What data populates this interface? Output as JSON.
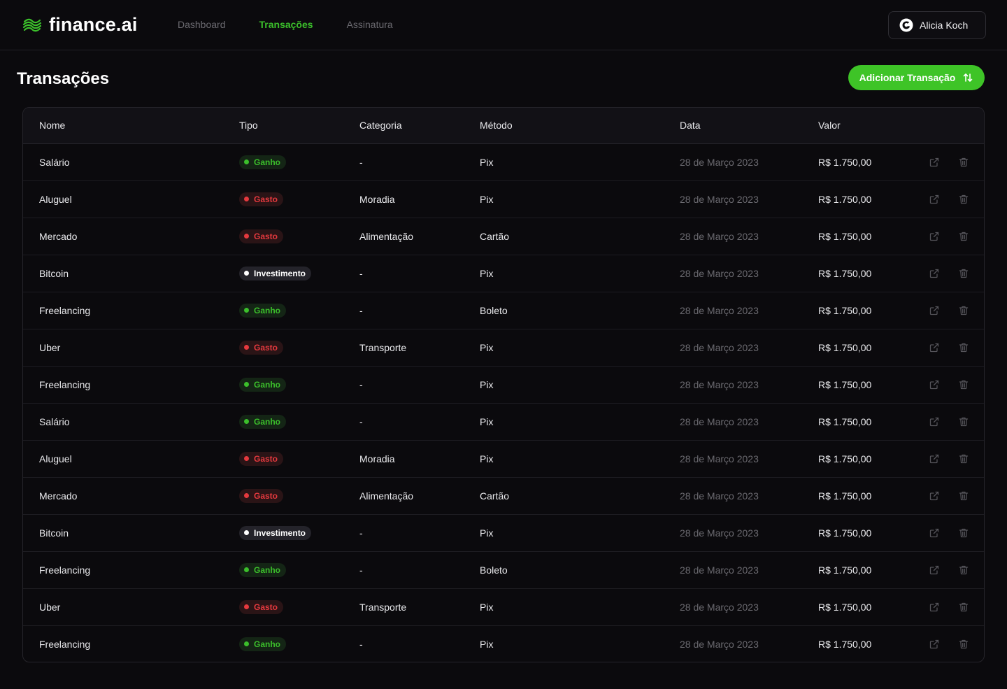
{
  "brand": {
    "name": "finance.ai"
  },
  "nav": [
    {
      "label": "Dashboard",
      "active": false
    },
    {
      "label": "Transações",
      "active": true
    },
    {
      "label": "Assinatura",
      "active": false
    }
  ],
  "user": {
    "name": "Alicia Koch"
  },
  "page": {
    "title": "Transações",
    "add_button_label": "Adicionar Transação"
  },
  "table": {
    "headers": {
      "nome": "Nome",
      "tipo": "Tipo",
      "categoria": "Categoria",
      "metodo": "Método",
      "data": "Data",
      "valor": "Valor"
    },
    "rows": [
      {
        "nome": "Salário",
        "tipo": "Ganho",
        "tipo_kind": "ganho",
        "categoria": "-",
        "metodo": "Pix",
        "data": "28 de Março 2023",
        "valor": "R$ 1.750,00"
      },
      {
        "nome": "Aluguel",
        "tipo": "Gasto",
        "tipo_kind": "gasto",
        "categoria": "Moradia",
        "metodo": "Pix",
        "data": "28 de Março 2023",
        "valor": "R$ 1.750,00"
      },
      {
        "nome": "Mercado",
        "tipo": "Gasto",
        "tipo_kind": "gasto",
        "categoria": "Alimentação",
        "metodo": "Cartão",
        "data": "28 de Março 2023",
        "valor": "R$ 1.750,00"
      },
      {
        "nome": "Bitcoin",
        "tipo": "Investimento",
        "tipo_kind": "investimento",
        "categoria": "-",
        "metodo": "Pix",
        "data": "28 de Março 2023",
        "valor": "R$ 1.750,00"
      },
      {
        "nome": "Freelancing",
        "tipo": "Ganho",
        "tipo_kind": "ganho",
        "categoria": "-",
        "metodo": "Boleto",
        "data": "28 de Março 2023",
        "valor": "R$ 1.750,00"
      },
      {
        "nome": "Uber",
        "tipo": "Gasto",
        "tipo_kind": "gasto",
        "categoria": "Transporte",
        "metodo": "Pix",
        "data": "28 de Março 2023",
        "valor": "R$ 1.750,00"
      },
      {
        "nome": "Freelancing",
        "tipo": "Ganho",
        "tipo_kind": "ganho",
        "categoria": "-",
        "metodo": "Pix",
        "data": "28 de Março 2023",
        "valor": "R$ 1.750,00"
      },
      {
        "nome": "Salário",
        "tipo": "Ganho",
        "tipo_kind": "ganho",
        "categoria": "-",
        "metodo": "Pix",
        "data": "28 de Março 2023",
        "valor": "R$ 1.750,00"
      },
      {
        "nome": "Aluguel",
        "tipo": "Gasto",
        "tipo_kind": "gasto",
        "categoria": "Moradia",
        "metodo": "Pix",
        "data": "28 de Março 2023",
        "valor": "R$ 1.750,00"
      },
      {
        "nome": "Mercado",
        "tipo": "Gasto",
        "tipo_kind": "gasto",
        "categoria": "Alimentação",
        "metodo": "Cartão",
        "data": "28 de Março 2023",
        "valor": "R$ 1.750,00"
      },
      {
        "nome": "Bitcoin",
        "tipo": "Investimento",
        "tipo_kind": "investimento",
        "categoria": "-",
        "metodo": "Pix",
        "data": "28 de Março 2023",
        "valor": "R$ 1.750,00"
      },
      {
        "nome": "Freelancing",
        "tipo": "Ganho",
        "tipo_kind": "ganho",
        "categoria": "-",
        "metodo": "Boleto",
        "data": "28 de Março 2023",
        "valor": "R$ 1.750,00"
      },
      {
        "nome": "Uber",
        "tipo": "Gasto",
        "tipo_kind": "gasto",
        "categoria": "Transporte",
        "metodo": "Pix",
        "data": "28 de Março 2023",
        "valor": "R$ 1.750,00"
      },
      {
        "nome": "Freelancing",
        "tipo": "Ganho",
        "tipo_kind": "ganho",
        "categoria": "-",
        "metodo": "Pix",
        "data": "28 de Março 2023",
        "valor": "R$ 1.750,00"
      }
    ],
    "row_actions": [
      "external-link-icon",
      "trash-icon"
    ]
  },
  "colors": {
    "accent": "#3ec427",
    "ganho": "#3bbf2b",
    "gasto": "#e5393e",
    "investimento": "#ffffff",
    "background": "#0b0a0d"
  },
  "icons": {
    "logo": "finance-logo-icon",
    "user": "user-avatar-icon",
    "add_button": "sort-arrows-icon"
  }
}
